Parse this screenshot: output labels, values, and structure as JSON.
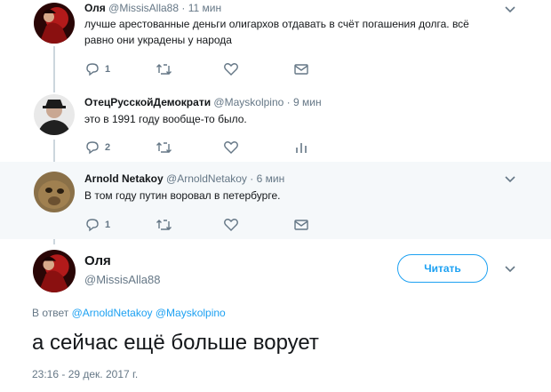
{
  "tweets": [
    {
      "display_name": "Оля",
      "handle": "@MissisAlla88",
      "separator": "·",
      "time": "11 мин",
      "text_lines": [
        "лучше арестованные деньги олигархов отдавать  в счёт погашения долга. всё",
        "равно они украдены у народа"
      ],
      "reply_count": "1"
    },
    {
      "display_name": "ОтецРусскойДемократи",
      "handle": "@Mayskolpino",
      "separator": "·",
      "time": "9 мин",
      "text_lines": [
        "это в 1991 году вообще-то было."
      ],
      "reply_count": "2"
    },
    {
      "display_name": "Arnold Netakoy",
      "handle": "@ArnoldNetakoy",
      "separator": "·",
      "time": "6 мин",
      "text_lines": [
        "В том году путин воровал в петербурге."
      ],
      "reply_count": "1"
    }
  ],
  "main": {
    "display_name": "Оля",
    "handle": "@MissisAlla88",
    "follow_label": "Читать",
    "reply_prefix": "В ответ",
    "mentions": [
      "@ArnoldNetakoy",
      "@Mayskolpino"
    ],
    "text": "а сейчас ещё больше ворует",
    "timestamp": "23:16 - 29 дек. 2017 г."
  },
  "colors": {
    "accent": "#1da1f2",
    "muted": "#657786",
    "highlight_bg": "#f5f8fa",
    "thread_line": "#ccd6dd"
  },
  "icons": [
    "reply-icon",
    "retweet-icon",
    "like-icon",
    "dm-icon",
    "analytics-icon",
    "chevron-down-icon"
  ]
}
